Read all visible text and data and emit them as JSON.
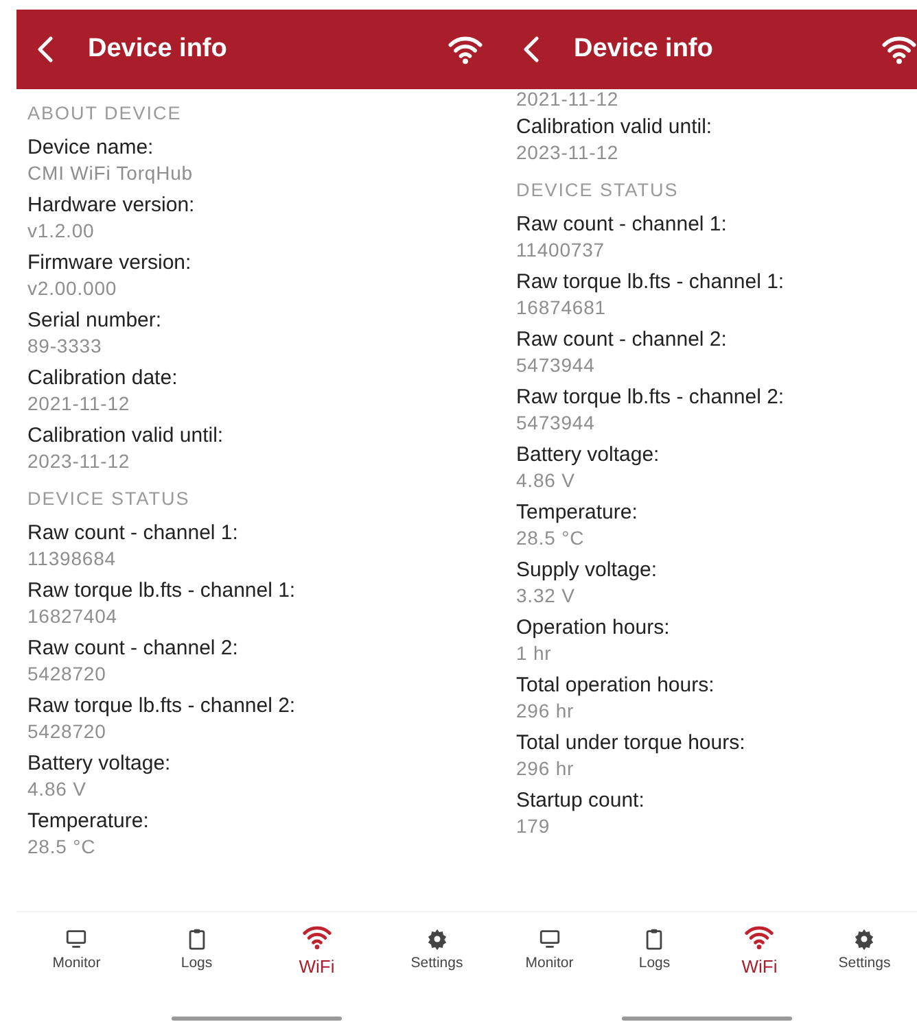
{
  "screens": [
    {
      "header": {
        "title": "Device info"
      },
      "content": [
        {
          "kind": "section",
          "text": "ABOUT DEVICE"
        },
        {
          "kind": "field",
          "label": "Device name:",
          "value": "CMI WiFi TorqHub"
        },
        {
          "kind": "field",
          "label": "Hardware version:",
          "value": "v1.2.00"
        },
        {
          "kind": "field",
          "label": "Firmware version:",
          "value": "v2.00.000"
        },
        {
          "kind": "field",
          "label": "Serial number:",
          "value": "89-3333"
        },
        {
          "kind": "field",
          "label": "Calibration date:",
          "value": "2021-11-12"
        },
        {
          "kind": "field",
          "label": "Calibration valid until:",
          "value": "2023-11-12"
        },
        {
          "kind": "section",
          "text": "DEVICE STATUS"
        },
        {
          "kind": "field",
          "label": "Raw count - channel 1:",
          "value": "11398684"
        },
        {
          "kind": "field",
          "label": "Raw torque lb.fts - channel 1:",
          "value": "16827404"
        },
        {
          "kind": "field",
          "label": "Raw count - channel 2:",
          "value": "5428720"
        },
        {
          "kind": "field",
          "label": "Raw torque lb.fts - channel 2:",
          "value": "5428720"
        },
        {
          "kind": "field",
          "label": "Battery voltage:",
          "value": "4.86 V"
        },
        {
          "kind": "field",
          "label": "Temperature:",
          "value": "28.5 °C"
        }
      ],
      "nav": [
        {
          "kind": "monitor",
          "label": "Monitor",
          "selected": false
        },
        {
          "kind": "clipboard",
          "label": "Logs",
          "selected": false
        },
        {
          "kind": "wifi",
          "label": "WiFi",
          "selected": true
        },
        {
          "kind": "gear",
          "label": "Settings",
          "selected": false
        }
      ]
    },
    {
      "header": {
        "title": "Device info"
      },
      "content": [
        {
          "kind": "value",
          "value": "2021-11-12"
        },
        {
          "kind": "field",
          "label": "Calibration valid until:",
          "value": "2023-11-12"
        },
        {
          "kind": "section",
          "text": "DEVICE STATUS"
        },
        {
          "kind": "field",
          "label": "Raw count - channel 1:",
          "value": "11400737"
        },
        {
          "kind": "field",
          "label": "Raw torque lb.fts - channel 1:",
          "value": "16874681"
        },
        {
          "kind": "field",
          "label": "Raw count - channel 2:",
          "value": "5473944"
        },
        {
          "kind": "field",
          "label": "Raw torque lb.fts - channel 2:",
          "value": "5473944"
        },
        {
          "kind": "field",
          "label": "Battery voltage:",
          "value": "4.86 V"
        },
        {
          "kind": "field",
          "label": "Temperature:",
          "value": "28.5 °C"
        },
        {
          "kind": "field",
          "label": "Supply voltage:",
          "value": "3.32 V"
        },
        {
          "kind": "field",
          "label": "Operation hours:",
          "value": "1 hr"
        },
        {
          "kind": "field",
          "label": "Total operation hours:",
          "value": "296 hr"
        },
        {
          "kind": "field",
          "label": "Total under torque hours:",
          "value": "296 hr"
        },
        {
          "kind": "field",
          "label": "Startup count:",
          "value": "179"
        }
      ],
      "nav": [
        {
          "kind": "monitor",
          "label": "Monitor",
          "selected": false
        },
        {
          "kind": "clipboard",
          "label": "Logs",
          "selected": false
        },
        {
          "kind": "wifi",
          "label": "WiFi",
          "selected": true
        },
        {
          "kind": "gear",
          "label": "Settings",
          "selected": false
        }
      ]
    }
  ]
}
